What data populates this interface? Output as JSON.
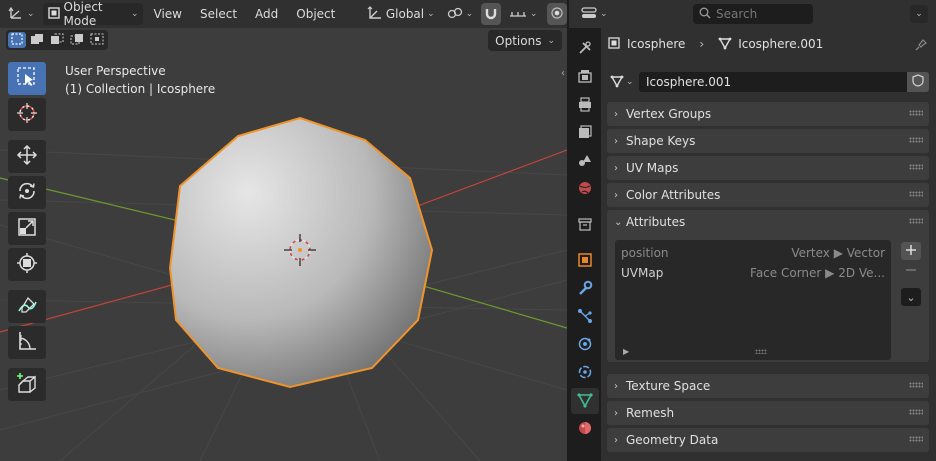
{
  "viewport": {
    "header": {
      "mode_label": "Object Mode",
      "menus": [
        "View",
        "Select",
        "Add",
        "Object"
      ],
      "orientation_label": "Global"
    },
    "options_label": "Options",
    "info_line1": "User Perspective",
    "info_line2": "(1) Collection | Icosphere",
    "tools": [
      "select-box",
      "cursor",
      "move",
      "rotate",
      "scale",
      "transform",
      "annotate",
      "measure",
      "add-cube"
    ]
  },
  "properties": {
    "search_placeholder": "Search",
    "breadcrumb_object": "Icosphere",
    "breadcrumb_mesh": "Icosphere.001",
    "datablock_name": "Icosphere.001",
    "tabs": [
      "tool",
      "render",
      "output",
      "view-layer",
      "scene",
      "world",
      "collection",
      "object",
      "modifiers",
      "particles",
      "physics",
      "constraints",
      "data",
      "material"
    ],
    "active_tab": "data",
    "panels": {
      "vertex_groups": "Vertex Groups",
      "shape_keys": "Shape Keys",
      "uv_maps": "UV Maps",
      "color_attributes": "Color Attributes",
      "attributes": "Attributes",
      "texture_space": "Texture Space",
      "remesh": "Remesh",
      "geometry_data": "Geometry Data"
    },
    "attributes": [
      {
        "name": "position",
        "domain": "Vertex ▶ Vector"
      },
      {
        "name": "UVMap",
        "domain": "Face Corner ▶ 2D Ve..."
      }
    ]
  },
  "colors": {
    "accent": "#4772b3",
    "selection_outline": "#f0932b",
    "axis_x": "#c3443a",
    "axis_y": "#6d9a2e",
    "data_tab_icon": "#3fbf8f"
  }
}
